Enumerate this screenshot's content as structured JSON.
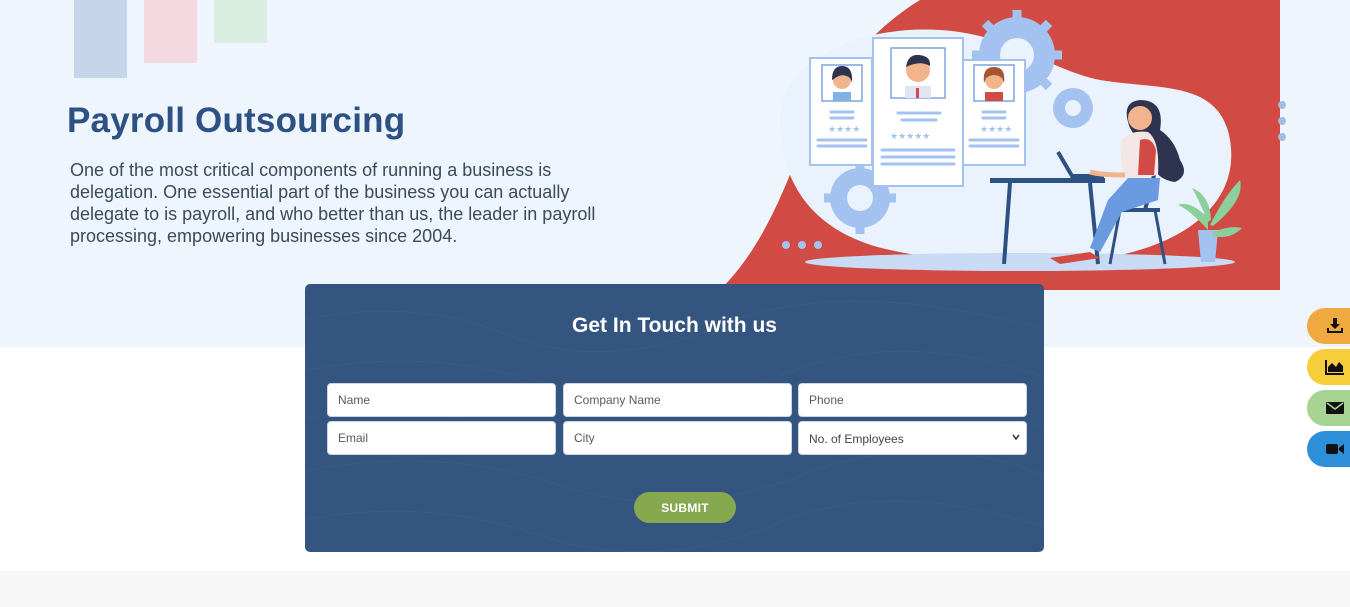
{
  "hero": {
    "title": "Payroll Outsourcing",
    "description": "One of the most critical components of running a business is delegation. One essential part of the business you can actually delegate to is payroll, and who better than us, the leader in payroll processing, empowering businesses since 2004."
  },
  "form": {
    "title": "Get In Touch with us",
    "fields": {
      "name": "Name",
      "company": "Company Name",
      "phone": "Phone",
      "email": "Email",
      "city": "City"
    },
    "employees_select": "No. of Employees",
    "submit_label": "SUBMIT"
  },
  "side_tabs": [
    {
      "icon": "download-icon",
      "color": "#f0a93e"
    },
    {
      "icon": "area-chart-icon",
      "color": "#f6cd3a"
    },
    {
      "icon": "envelope-icon",
      "color": "#a7d492"
    },
    {
      "icon": "video-camera-icon",
      "color": "#2d8fd9"
    }
  ],
  "colors": {
    "brand_blue": "#2d5183",
    "form_bg": "#33557f",
    "submit_green": "#86a94f",
    "hero_red": "#d14b44"
  }
}
